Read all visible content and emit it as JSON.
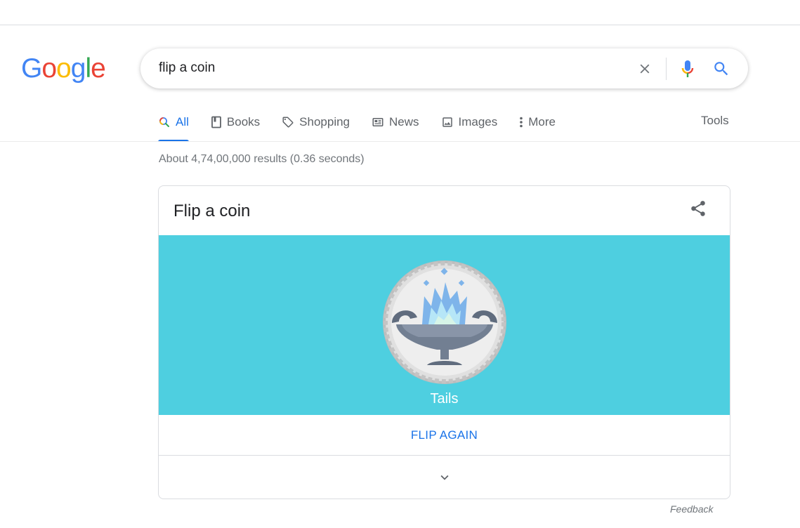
{
  "logo": {
    "letters": [
      "G",
      "o",
      "o",
      "g",
      "l",
      "e"
    ],
    "colors": [
      "#4285F4",
      "#EA4335",
      "#FBBC05",
      "#4285F4",
      "#34A853",
      "#EA4335"
    ]
  },
  "search": {
    "value": "flip a coin",
    "icons": {
      "clear": "close-icon",
      "voice": "microphone-icon",
      "submit": "search-icon"
    }
  },
  "tabs": [
    {
      "label": "All",
      "icon": "search-icon",
      "active": true
    },
    {
      "label": "Books",
      "icon": "book-icon",
      "active": false
    },
    {
      "label": "Shopping",
      "icon": "tag-icon",
      "active": false
    },
    {
      "label": "News",
      "icon": "newspaper-icon",
      "active": false
    },
    {
      "label": "Images",
      "icon": "image-icon",
      "active": false
    },
    {
      "label": "More",
      "icon": "more-vertical-icon",
      "active": false
    }
  ],
  "tools_label": "Tools",
  "results_count": "About 4,74,00,000 results (0.36 seconds)",
  "card": {
    "title": "Flip a coin",
    "share_icon": "share-icon",
    "coin_background": "#4ecfe0",
    "result": "Tails",
    "flip_again_label": "FLIP AGAIN",
    "expand_icon": "chevron-down-icon"
  },
  "feedback_label": "Feedback",
  "colors": {
    "accent": "#1a73e8",
    "muted_text": "#70757a"
  }
}
